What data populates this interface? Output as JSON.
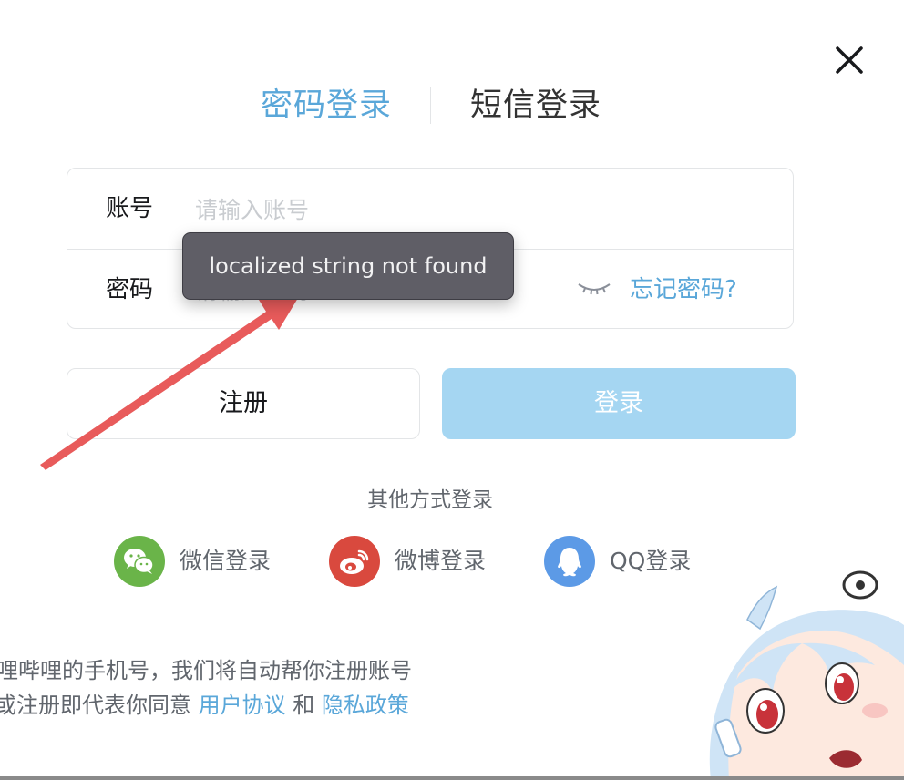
{
  "header": {
    "tabs": [
      {
        "label": "密码登录",
        "active": true
      },
      {
        "label": "短信登录",
        "active": false
      }
    ]
  },
  "form": {
    "account": {
      "label": "账号",
      "placeholder": "请输入账号",
      "value": ""
    },
    "password": {
      "label": "密码",
      "placeholder": "请输入密码",
      "value": ""
    },
    "forgot_label": "忘记密码?"
  },
  "buttons": {
    "register_label": "注册",
    "login_label": "登录"
  },
  "social": {
    "title": "其他方式登录",
    "items": [
      {
        "label": "微信登录",
        "icon": "wechat-icon",
        "color": "#6ab449"
      },
      {
        "label": "微博登录",
        "icon": "weibo-icon",
        "color": "#d9493e"
      },
      {
        "label": "QQ登录",
        "icon": "qq-icon",
        "color": "#5c9ae6"
      }
    ]
  },
  "notes": {
    "line1": "哩哔哩的手机号，我们将自动帮你注册账号",
    "line2_prefix": "或注册即代表你同意",
    "user_agreement": "用户协议",
    "and": "和",
    "privacy_policy": "隐私政策"
  },
  "tooltip": {
    "text": "localized string not found"
  },
  "colors": {
    "accent": "#5aa7d9",
    "login_button_bg": "#a5d6f2",
    "tooltip_bg": "#5f5e66",
    "annotation_arrow": "#e85b5b"
  }
}
